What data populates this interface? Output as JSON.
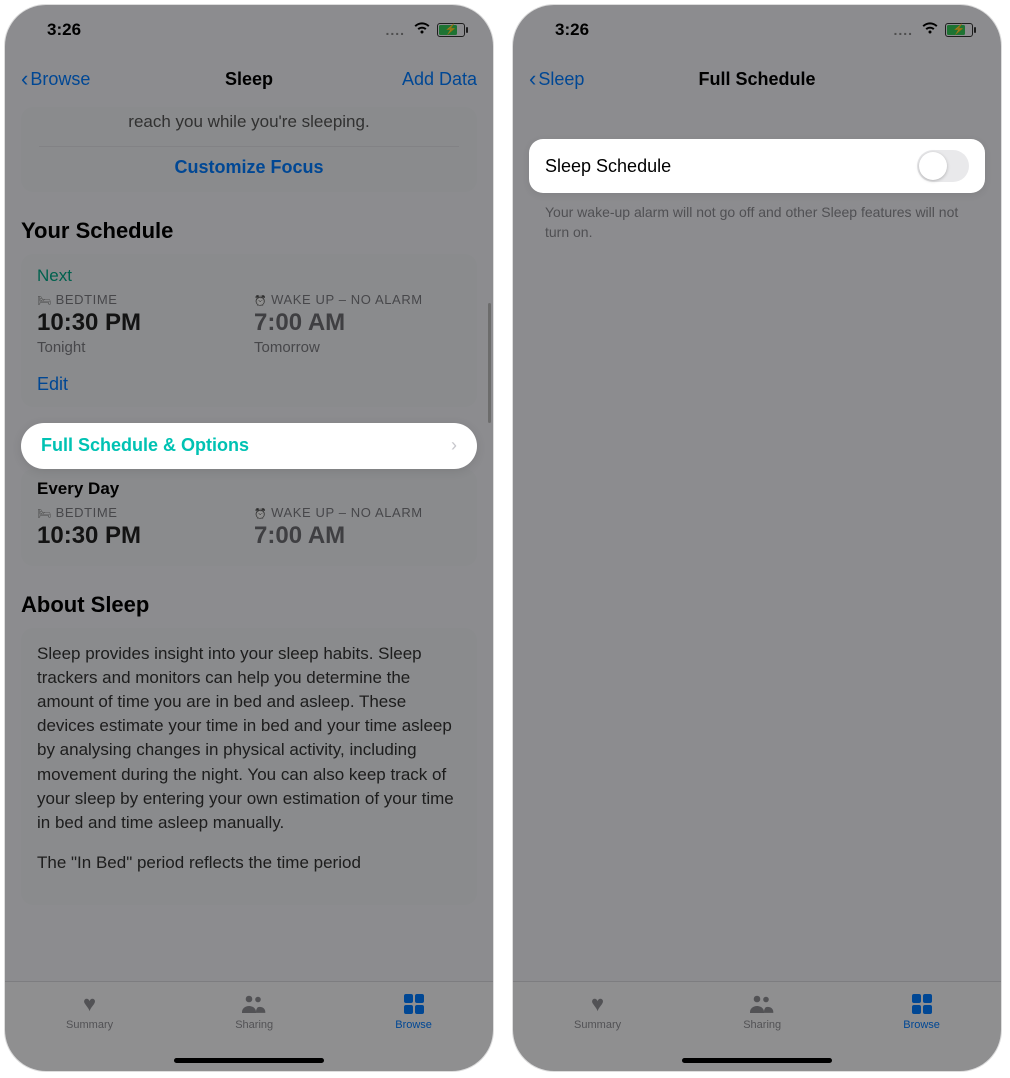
{
  "status": {
    "time": "3:26",
    "dots": "....",
    "battery_charging": true
  },
  "left": {
    "nav": {
      "back": "Browse",
      "title": "Sleep",
      "right": "Add Data"
    },
    "focus": {
      "text": "reach you while you're sleeping.",
      "link": "Customize Focus"
    },
    "your_schedule": {
      "header": "Your Schedule",
      "next_label": "Next",
      "bed_label": "BEDTIME",
      "bed_time": "10:30 PM",
      "bed_sub": "Tonight",
      "wake_label": "WAKE UP – NO ALARM",
      "wake_time": "7:00 AM",
      "wake_sub": "Tomorrow",
      "edit": "Edit"
    },
    "full_row": "Full Schedule & Options",
    "every": {
      "title": "Every Day",
      "bed_label": "BEDTIME",
      "bed_time": "10:30 PM",
      "wake_label": "WAKE UP – NO ALARM",
      "wake_time": "7:00 AM"
    },
    "about": {
      "header": "About Sleep",
      "p1": "Sleep provides insight into your sleep habits. Sleep trackers and monitors can help you determine the amount of time you are in bed and asleep. These devices estimate your time in bed and your time asleep by analysing changes in physical activity, including movement during the night. You can also keep track of your sleep by entering your own estimation of your time in bed and time asleep manually.",
      "p2": "The \"In Bed\" period reflects the time period"
    }
  },
  "right": {
    "nav": {
      "back": "Sleep",
      "title": "Full Schedule"
    },
    "switch_label": "Sleep Schedule",
    "switch_on": false,
    "note": "Your wake-up alarm will not go off and other Sleep features will not turn on."
  },
  "tabs": {
    "summary": "Summary",
    "sharing": "Sharing",
    "browse": "Browse"
  }
}
